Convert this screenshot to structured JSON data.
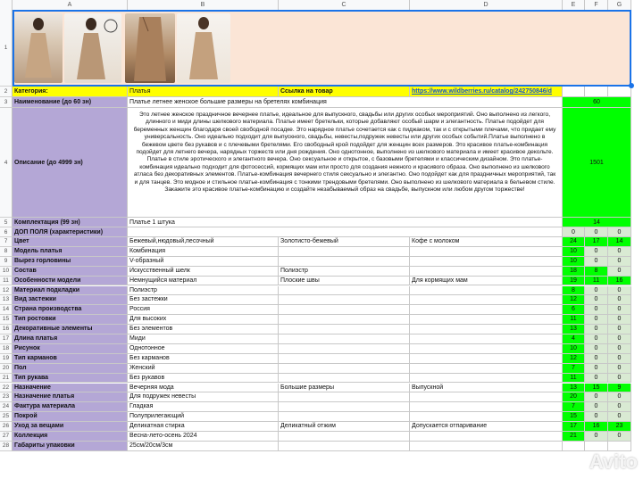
{
  "columns": [
    "A",
    "B",
    "C",
    "D",
    "E",
    "F",
    "G"
  ],
  "row_numbers": [
    "1",
    "2",
    "3",
    "4",
    "5",
    "6",
    "7",
    "8",
    "9",
    "10",
    "11",
    "12",
    "13",
    "14",
    "15",
    "16",
    "17",
    "18",
    "19",
    "20",
    "21",
    "22",
    "23",
    "24",
    "25",
    "26",
    "27",
    "28"
  ],
  "category": {
    "label": "Категория:",
    "value": "Платья",
    "link_label": "Ссылка на товар",
    "link": "https://www.wildberries.ru/catalog/242750846/d"
  },
  "title": {
    "label": "Наименование (до 60 зн)",
    "value": "Платье летнее женское большие размеры на бретелях комбинация",
    "count": "60"
  },
  "description": {
    "label": "Описание (до 4999 зн)",
    "value": "Это летнее женское праздничное вечернее платье, идеальное для выпускного, свадьбы или других особых мероприятий. Оно выполнено из легкого, длинного и миди длины шелкового материала. Платье имеет бретельки, которые добавляют особый шарм и элегантность. Платье подойдет для беременных женщин благодаря своей свободной посадке. Это нарядное платье сочетается как с пиджаком, так и с открытыми плечами, что придает ему универсальность. Оно идеально подходит для выпускного, свадьбы, невесты,подружек невесты или других особых событий.Платье выполнено в бежевом цвете без рукавов и с плечевыми бретелями. Его свободный крой подойдет для женщин всех размеров. Это красивое платье-комбинация подойдет для летнего вечера, нарядных торжеств или дня рождения. Оно однотонное, выполнено из шелкового материала и имеет красивое декольте. Платье в стиле эротического и элегантного вечера. Оно сексуальное и открытое, с базовыми бретелями и классическим дизайном. Это платье-комбинация идеально подходит для фотосессий, кормящих мам или просто для создания нежного и красивого образа. Оно выполнено из шелкового атласа без декоративных элементов. Платье-комбинация вечернего стиля сексуально и элегантно. Оно подойдет как для праздничных мероприятий, так и для танцев. Это модное и стильное платье-комбинация с тонкими трендовыми бретелями. Оно выполнено из шелкового материала в бельевом стиле. Закажите это красивое платье-комбинацию и создайте незабываемый образ на свадьбе, выпускном или любом другом торжестве!",
    "count": "1501"
  },
  "kit": {
    "label": "Комплектация (99 зн)",
    "value": "Платье 1 штука",
    "count": "14"
  },
  "extra": {
    "label": "ДОП ПОЛЯ (характеристики)",
    "e": "0",
    "f": "0",
    "g": "0"
  },
  "rows": [
    {
      "label": "Цвет",
      "b": "Бежевый,нюдовый,песочный",
      "c": "Золотисто-бежевый",
      "d": "Кофе с молоком",
      "e": "24",
      "f": "17",
      "g": "14"
    },
    {
      "label": "Модель платья",
      "b": "Комбинация",
      "c": "",
      "d": "",
      "e": "10",
      "f": "0",
      "g": "0"
    },
    {
      "label": "Вырез горловины",
      "b": "V-образный",
      "c": "",
      "d": "",
      "e": "10",
      "f": "0",
      "g": "0"
    },
    {
      "label": "Состав",
      "b": "Искусственный шелк",
      "c": "Полиэстр",
      "d": "",
      "e": "18",
      "f": "8",
      "g": "0"
    },
    {
      "label": "Особенности модели",
      "b": "Немнущийся материал",
      "c": "Плоские швы",
      "d": "Для кормящих мам",
      "e": "19",
      "f": "11",
      "g": "16"
    },
    {
      "label": "Материал подкладки",
      "b": "Полиэстр",
      "c": "",
      "d": "",
      "e": "8",
      "f": "0",
      "g": "0"
    },
    {
      "label": "Вид застежки",
      "b": "Без застежки",
      "c": "",
      "d": "",
      "e": "12",
      "f": "0",
      "g": "0"
    },
    {
      "label": "Страна производства",
      "b": "Россия",
      "c": "",
      "d": "",
      "e": "6",
      "f": "0",
      "g": "0"
    },
    {
      "label": "Тип ростовки",
      "b": "Для высоких",
      "c": "",
      "d": "",
      "e": "11",
      "f": "0",
      "g": "0"
    },
    {
      "label": "Декоративные элементы",
      "b": "Без элементов",
      "c": "",
      "d": "",
      "e": "13",
      "f": "0",
      "g": "0"
    },
    {
      "label": "Длина платья",
      "b": "Миди",
      "c": "",
      "d": "",
      "e": "4",
      "f": "0",
      "g": "0"
    },
    {
      "label": "Рисунок",
      "b": "Однотонное",
      "c": "",
      "d": "",
      "e": "10",
      "f": "0",
      "g": "0"
    },
    {
      "label": "Тип карманов",
      "b": "Без карманов",
      "c": "",
      "d": "",
      "e": "12",
      "f": "0",
      "g": "0"
    },
    {
      "label": "Пол",
      "b": "Женский",
      "c": "",
      "d": "",
      "e": "7",
      "f": "0",
      "g": "0"
    },
    {
      "label": "Тип рукава",
      "b": "Без рукавов",
      "c": "",
      "d": "",
      "e": "11",
      "f": "0",
      "g": "0"
    },
    {
      "label": "Назначение",
      "b": "Вечерняя мода",
      "c": "Большие размеры",
      "d": "Выпускной",
      "e": "13",
      "f": "15",
      "g": "9"
    },
    {
      "label": "Назначение платья",
      "b": "Для подружек невесты",
      "c": "",
      "d": "",
      "e": "20",
      "f": "0",
      "g": "0"
    },
    {
      "label": "Фактура материала",
      "b": "Гладкая",
      "c": "",
      "d": "",
      "e": "7",
      "f": "0",
      "g": "0"
    },
    {
      "label": "Покрой",
      "b": "Полуприлегающий",
      "c": "",
      "d": "",
      "e": "15",
      "f": "0",
      "g": "0"
    },
    {
      "label": "Уход за вещами",
      "b": "Деликатная стирка",
      "c": "Деликатный отжим",
      "d": "Допускается отпаривание",
      "e": "17",
      "f": "16",
      "g": "23"
    },
    {
      "label": "Коллекция",
      "b": "Весна-лето-осень 2024",
      "c": "",
      "d": "",
      "e": "21",
      "f": "0",
      "g": "0"
    },
    {
      "label": "Габариты упаковки",
      "b": "25см/20см/3см",
      "c": "",
      "d": "",
      "e": "",
      "f": "",
      "g": ""
    }
  ],
  "photos": [
    "photo-1",
    "photo-2",
    "photo-3",
    "photo-4"
  ],
  "watermark": "Avito",
  "colors": {
    "label_bg": "#b4a7d6",
    "yellow": "#ffff00",
    "green": "#00ff00",
    "selection": "#1a73e8"
  }
}
